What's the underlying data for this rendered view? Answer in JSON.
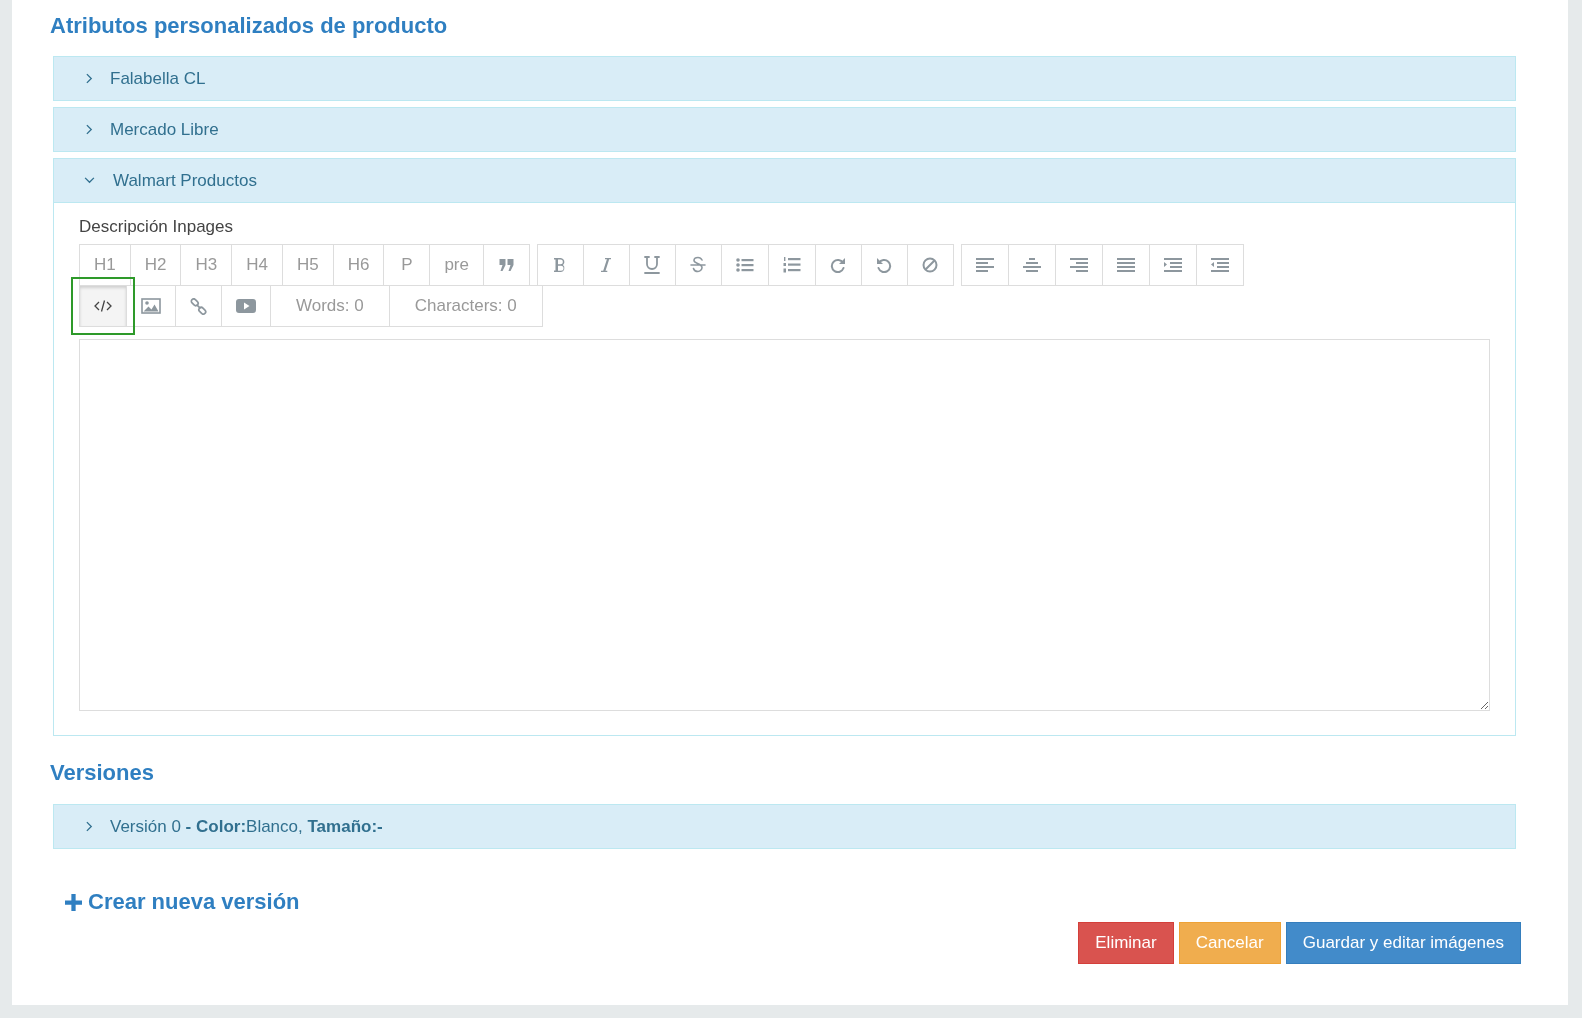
{
  "attributes": {
    "title": "Atributos personalizados de producto",
    "panels": [
      {
        "title": "Falabella CL",
        "expanded": false
      },
      {
        "title": "Mercado Libre",
        "expanded": false
      },
      {
        "title": "Walmart Productos",
        "expanded": true,
        "field_label": "Descripción Inpages",
        "toolbar_rows": [
          [
            [
              {
                "kind": "text",
                "label": "H1",
                "selected": false
              },
              {
                "kind": "text",
                "label": "H2",
                "selected": false
              },
              {
                "kind": "text",
                "label": "H3",
                "selected": false
              },
              {
                "kind": "text",
                "label": "H4",
                "selected": false
              },
              {
                "kind": "text",
                "label": "H5",
                "selected": false
              },
              {
                "kind": "text",
                "label": "H6",
                "selected": false
              },
              {
                "kind": "text",
                "label": "P",
                "selected": false
              },
              {
                "kind": "text",
                "label": "pre",
                "selected": false
              },
              {
                "kind": "quote",
                "selected": false
              }
            ],
            [
              {
                "kind": "bold",
                "selected": false
              },
              {
                "kind": "italic",
                "selected": false
              },
              {
                "kind": "underline",
                "selected": false
              },
              {
                "kind": "strike",
                "selected": false
              },
              {
                "kind": "bullets",
                "selected": false
              },
              {
                "kind": "numbers",
                "selected": false
              },
              {
                "kind": "redo",
                "selected": false
              },
              {
                "kind": "undo",
                "selected": false
              },
              {
                "kind": "clear",
                "selected": false
              }
            ],
            [
              {
                "kind": "align-left",
                "selected": false
              },
              {
                "kind": "align-center",
                "selected": false
              },
              {
                "kind": "align-right",
                "selected": false
              },
              {
                "kind": "justify",
                "selected": false
              },
              {
                "kind": "indent",
                "selected": false
              },
              {
                "kind": "outdent",
                "selected": false
              }
            ]
          ],
          [
            [
              {
                "kind": "code",
                "selected": true
              },
              {
                "kind": "image",
                "selected": false
              },
              {
                "kind": "link",
                "selected": false
              },
              {
                "kind": "video",
                "selected": false
              },
              {
                "kind": "counter",
                "label": "Words: 0"
              },
              {
                "kind": "counter",
                "label": "Characters: 0"
              }
            ]
          ]
        ]
      }
    ]
  },
  "versions": {
    "title": "Versiones",
    "panels": [
      {
        "title": "Versión 0 **- Color:**Blanco, **Tamaño:-**",
        "expanded": false
      }
    ],
    "create_link": "Crear nueva versión"
  },
  "buttons": [
    {
      "kind": "danger",
      "label": "Eliminar"
    },
    {
      "kind": "warning",
      "label": "Cancelar"
    },
    {
      "kind": "primary",
      "label": "Guardar y editar imágenes"
    }
  ]
}
